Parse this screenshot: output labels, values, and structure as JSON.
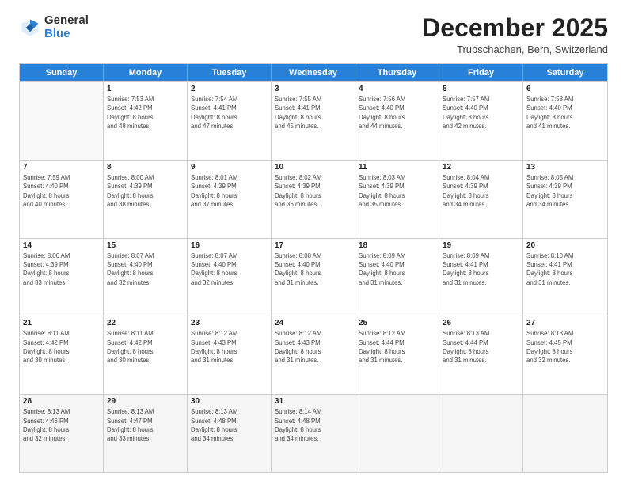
{
  "logo": {
    "general": "General",
    "blue": "Blue"
  },
  "header": {
    "month": "December 2025",
    "location": "Trubschachen, Bern, Switzerland"
  },
  "weekdays": [
    "Sunday",
    "Monday",
    "Tuesday",
    "Wednesday",
    "Thursday",
    "Friday",
    "Saturday"
  ],
  "rows": [
    [
      {
        "day": "",
        "info": ""
      },
      {
        "day": "1",
        "info": "Sunrise: 7:53 AM\nSunset: 4:42 PM\nDaylight: 8 hours\nand 48 minutes."
      },
      {
        "day": "2",
        "info": "Sunrise: 7:54 AM\nSunset: 4:41 PM\nDaylight: 8 hours\nand 47 minutes."
      },
      {
        "day": "3",
        "info": "Sunrise: 7:55 AM\nSunset: 4:41 PM\nDaylight: 8 hours\nand 45 minutes."
      },
      {
        "day": "4",
        "info": "Sunrise: 7:56 AM\nSunset: 4:40 PM\nDaylight: 8 hours\nand 44 minutes."
      },
      {
        "day": "5",
        "info": "Sunrise: 7:57 AM\nSunset: 4:40 PM\nDaylight: 8 hours\nand 42 minutes."
      },
      {
        "day": "6",
        "info": "Sunrise: 7:58 AM\nSunset: 4:40 PM\nDaylight: 8 hours\nand 41 minutes."
      }
    ],
    [
      {
        "day": "7",
        "info": "Sunrise: 7:59 AM\nSunset: 4:40 PM\nDaylight: 8 hours\nand 40 minutes."
      },
      {
        "day": "8",
        "info": "Sunrise: 8:00 AM\nSunset: 4:39 PM\nDaylight: 8 hours\nand 38 minutes."
      },
      {
        "day": "9",
        "info": "Sunrise: 8:01 AM\nSunset: 4:39 PM\nDaylight: 8 hours\nand 37 minutes."
      },
      {
        "day": "10",
        "info": "Sunrise: 8:02 AM\nSunset: 4:39 PM\nDaylight: 8 hours\nand 36 minutes."
      },
      {
        "day": "11",
        "info": "Sunrise: 8:03 AM\nSunset: 4:39 PM\nDaylight: 8 hours\nand 35 minutes."
      },
      {
        "day": "12",
        "info": "Sunrise: 8:04 AM\nSunset: 4:39 PM\nDaylight: 8 hours\nand 34 minutes."
      },
      {
        "day": "13",
        "info": "Sunrise: 8:05 AM\nSunset: 4:39 PM\nDaylight: 8 hours\nand 34 minutes."
      }
    ],
    [
      {
        "day": "14",
        "info": "Sunrise: 8:06 AM\nSunset: 4:39 PM\nDaylight: 8 hours\nand 33 minutes."
      },
      {
        "day": "15",
        "info": "Sunrise: 8:07 AM\nSunset: 4:40 PM\nDaylight: 8 hours\nand 32 minutes."
      },
      {
        "day": "16",
        "info": "Sunrise: 8:07 AM\nSunset: 4:40 PM\nDaylight: 8 hours\nand 32 minutes."
      },
      {
        "day": "17",
        "info": "Sunrise: 8:08 AM\nSunset: 4:40 PM\nDaylight: 8 hours\nand 31 minutes."
      },
      {
        "day": "18",
        "info": "Sunrise: 8:09 AM\nSunset: 4:40 PM\nDaylight: 8 hours\nand 31 minutes."
      },
      {
        "day": "19",
        "info": "Sunrise: 8:09 AM\nSunset: 4:41 PM\nDaylight: 8 hours\nand 31 minutes."
      },
      {
        "day": "20",
        "info": "Sunrise: 8:10 AM\nSunset: 4:41 PM\nDaylight: 8 hours\nand 31 minutes."
      }
    ],
    [
      {
        "day": "21",
        "info": "Sunrise: 8:11 AM\nSunset: 4:42 PM\nDaylight: 8 hours\nand 30 minutes."
      },
      {
        "day": "22",
        "info": "Sunrise: 8:11 AM\nSunset: 4:42 PM\nDaylight: 8 hours\nand 30 minutes."
      },
      {
        "day": "23",
        "info": "Sunrise: 8:12 AM\nSunset: 4:43 PM\nDaylight: 8 hours\nand 31 minutes."
      },
      {
        "day": "24",
        "info": "Sunrise: 8:12 AM\nSunset: 4:43 PM\nDaylight: 8 hours\nand 31 minutes."
      },
      {
        "day": "25",
        "info": "Sunrise: 8:12 AM\nSunset: 4:44 PM\nDaylight: 8 hours\nand 31 minutes."
      },
      {
        "day": "26",
        "info": "Sunrise: 8:13 AM\nSunset: 4:44 PM\nDaylight: 8 hours\nand 31 minutes."
      },
      {
        "day": "27",
        "info": "Sunrise: 8:13 AM\nSunset: 4:45 PM\nDaylight: 8 hours\nand 32 minutes."
      }
    ],
    [
      {
        "day": "28",
        "info": "Sunrise: 8:13 AM\nSunset: 4:46 PM\nDaylight: 8 hours\nand 32 minutes."
      },
      {
        "day": "29",
        "info": "Sunrise: 8:13 AM\nSunset: 4:47 PM\nDaylight: 8 hours\nand 33 minutes."
      },
      {
        "day": "30",
        "info": "Sunrise: 8:13 AM\nSunset: 4:48 PM\nDaylight: 8 hours\nand 34 minutes."
      },
      {
        "day": "31",
        "info": "Sunrise: 8:14 AM\nSunset: 4:48 PM\nDaylight: 8 hours\nand 34 minutes."
      },
      {
        "day": "",
        "info": ""
      },
      {
        "day": "",
        "info": ""
      },
      {
        "day": "",
        "info": ""
      }
    ]
  ]
}
